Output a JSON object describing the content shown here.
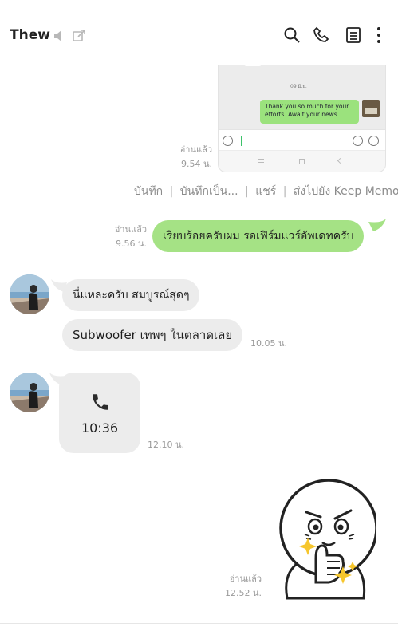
{
  "header": {
    "title": "Thew",
    "icons": [
      "mute-icon",
      "popout-icon",
      "search-icon",
      "call-icon",
      "notes-icon",
      "more-icon"
    ]
  },
  "messages": {
    "screenshot": {
      "inner_date": "09 มิ.ย.",
      "inner_bubble_text": "Thank you so much for your efforts. Await your news",
      "read": "อ่านแล้ว",
      "time": "9.54 น."
    },
    "actions": [
      "บันทึก",
      "บันทึกเป็น...",
      "แชร์",
      "ส่งไปยัง Keep Memo"
    ],
    "action_separator": "|",
    "m1": {
      "text": "เรียบร้อยครับผม รอเฟิร์มแวร์อัพเดทครับ",
      "read": "อ่านแล้ว",
      "time": "9.56 น."
    },
    "m2": {
      "text": "นี่แหละครับ สมบูรณ์สุดๆ"
    },
    "m3": {
      "text": "Subwoofer เทพๆ ในตลาดเลย",
      "time": "10.05 น."
    },
    "call": {
      "duration": "10:36",
      "time": "12.10 น."
    },
    "sticker": {
      "read": "อ่านแล้ว",
      "time": "12.52 น."
    }
  },
  "colors": {
    "my_bubble": "#a5e285",
    "their_bubble": "#ececec",
    "meta_text": "#9a9a9a"
  }
}
